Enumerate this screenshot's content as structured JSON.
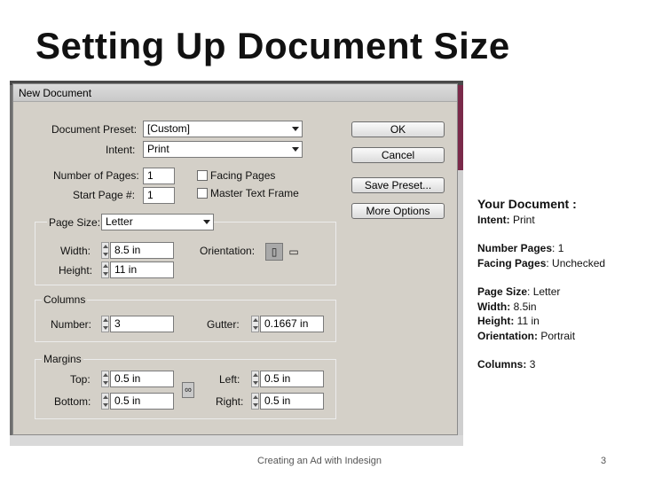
{
  "slide": {
    "title": "Setting Up Document Size",
    "footer": "Creating an Ad with Indesign",
    "page_number": "3"
  },
  "dialog": {
    "title": "New Document",
    "preset_label": "Document Preset:",
    "preset_value": "[Custom]",
    "intent_label": "Intent:",
    "intent_value": "Print",
    "pages_label": "Number of Pages:",
    "pages_value": "1",
    "start_label": "Start Page #:",
    "start_value": "1",
    "facing_label": "Facing Pages",
    "master_label": "Master Text Frame",
    "pagesize_label": "Page Size:",
    "pagesize_value": "Letter",
    "width_label": "Width:",
    "width_value": "8.5 in",
    "height_label": "Height:",
    "height_value": "11 in",
    "orientation_label": "Orientation:",
    "columns_group": "Columns",
    "number_label": "Number:",
    "number_value": "3",
    "gutter_label": "Gutter:",
    "gutter_value": "0.1667 in",
    "margins_group": "Margins",
    "top_label": "Top:",
    "top_value": "0.5 in",
    "bottom_label": "Bottom:",
    "bottom_value": "0.5 in",
    "left_label": "Left:",
    "left_value": "0.5 in",
    "right_label": "Right:",
    "right_value": "0.5 in",
    "buttons": {
      "ok": "OK",
      "cancel": "Cancel",
      "save_preset": "Save Preset...",
      "more_options": "More Options"
    }
  },
  "summary": {
    "heading": "Your Document :",
    "intent_key": "Intent:",
    "intent_val": "Print",
    "pages_key": "Number Pages",
    "pages_val": ": 1",
    "facing_key": "Facing Pages",
    "facing_val": ": Unchecked",
    "size_key": "Page Size",
    "size_val": ": Letter",
    "width_key": "Width:",
    "width_val": "8.5in",
    "height_key": "Height:",
    "height_val": "11 in",
    "orient_key": "Orientation:",
    "orient_val": "Portrait",
    "columns_key": "Columns:",
    "columns_val": "3"
  }
}
